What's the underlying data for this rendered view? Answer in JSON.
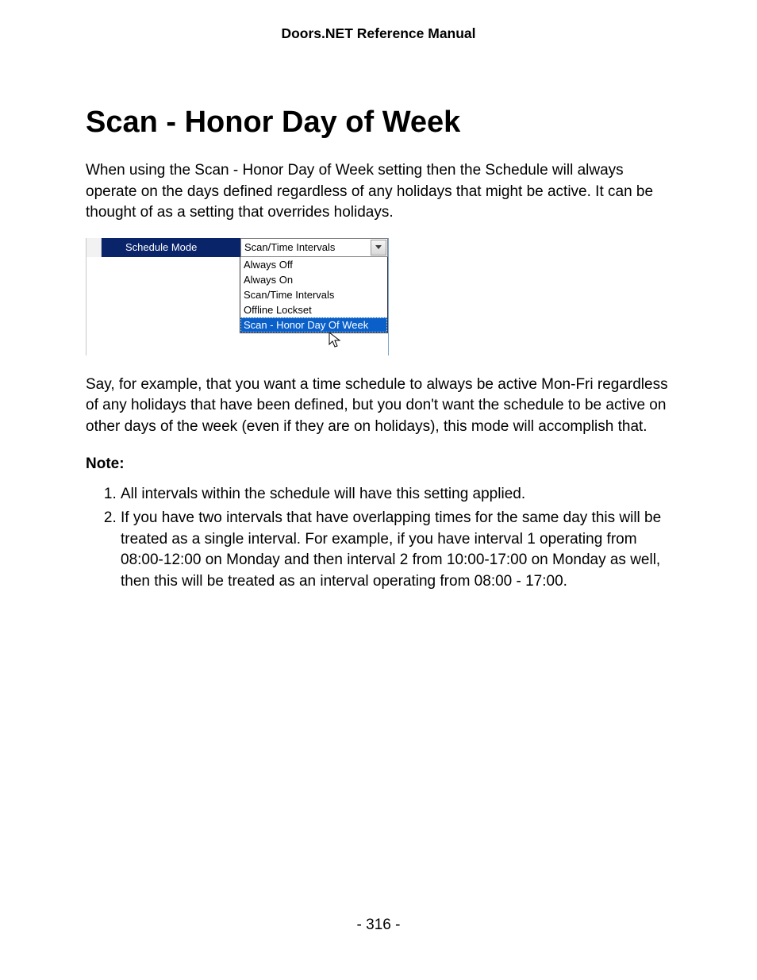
{
  "header": "Doors.NET Reference Manual",
  "title": "Scan - Honor Day of Week",
  "intro": "When using the Scan - Honor Day of Week setting then the Schedule will always operate on the days defined regardless of any holidays that might be active. It can be thought of as a setting that overrides holidays.",
  "example": "Say, for example, that you want a time schedule to always be active Mon-Fri regardless of any holidays that have been defined, but you don't want the schedule to be active on other days of the week (even if they are on holidays), this mode will accomplish that.",
  "note_label": "Note:",
  "notes": [
    "All intervals within the schedule will have this setting applied.",
    "If you have two intervals that have overlapping times for the same day this will be treated as a single interval. For example, if you have interval 1 operating from 08:00-12:00 on Monday and then interval 2 from 10:00-17:00 on Monday as well, then this will be treated as an interval operating from 08:00 - 17:00."
  ],
  "page_number": "- 316 -",
  "dropdown": {
    "label": "Schedule Mode",
    "selected_value": "Scan/Time Intervals",
    "items": [
      "Always Off",
      "Always On",
      "Scan/Time Intervals",
      "Offline Lockset",
      "Scan - Honor Day Of Week"
    ]
  }
}
